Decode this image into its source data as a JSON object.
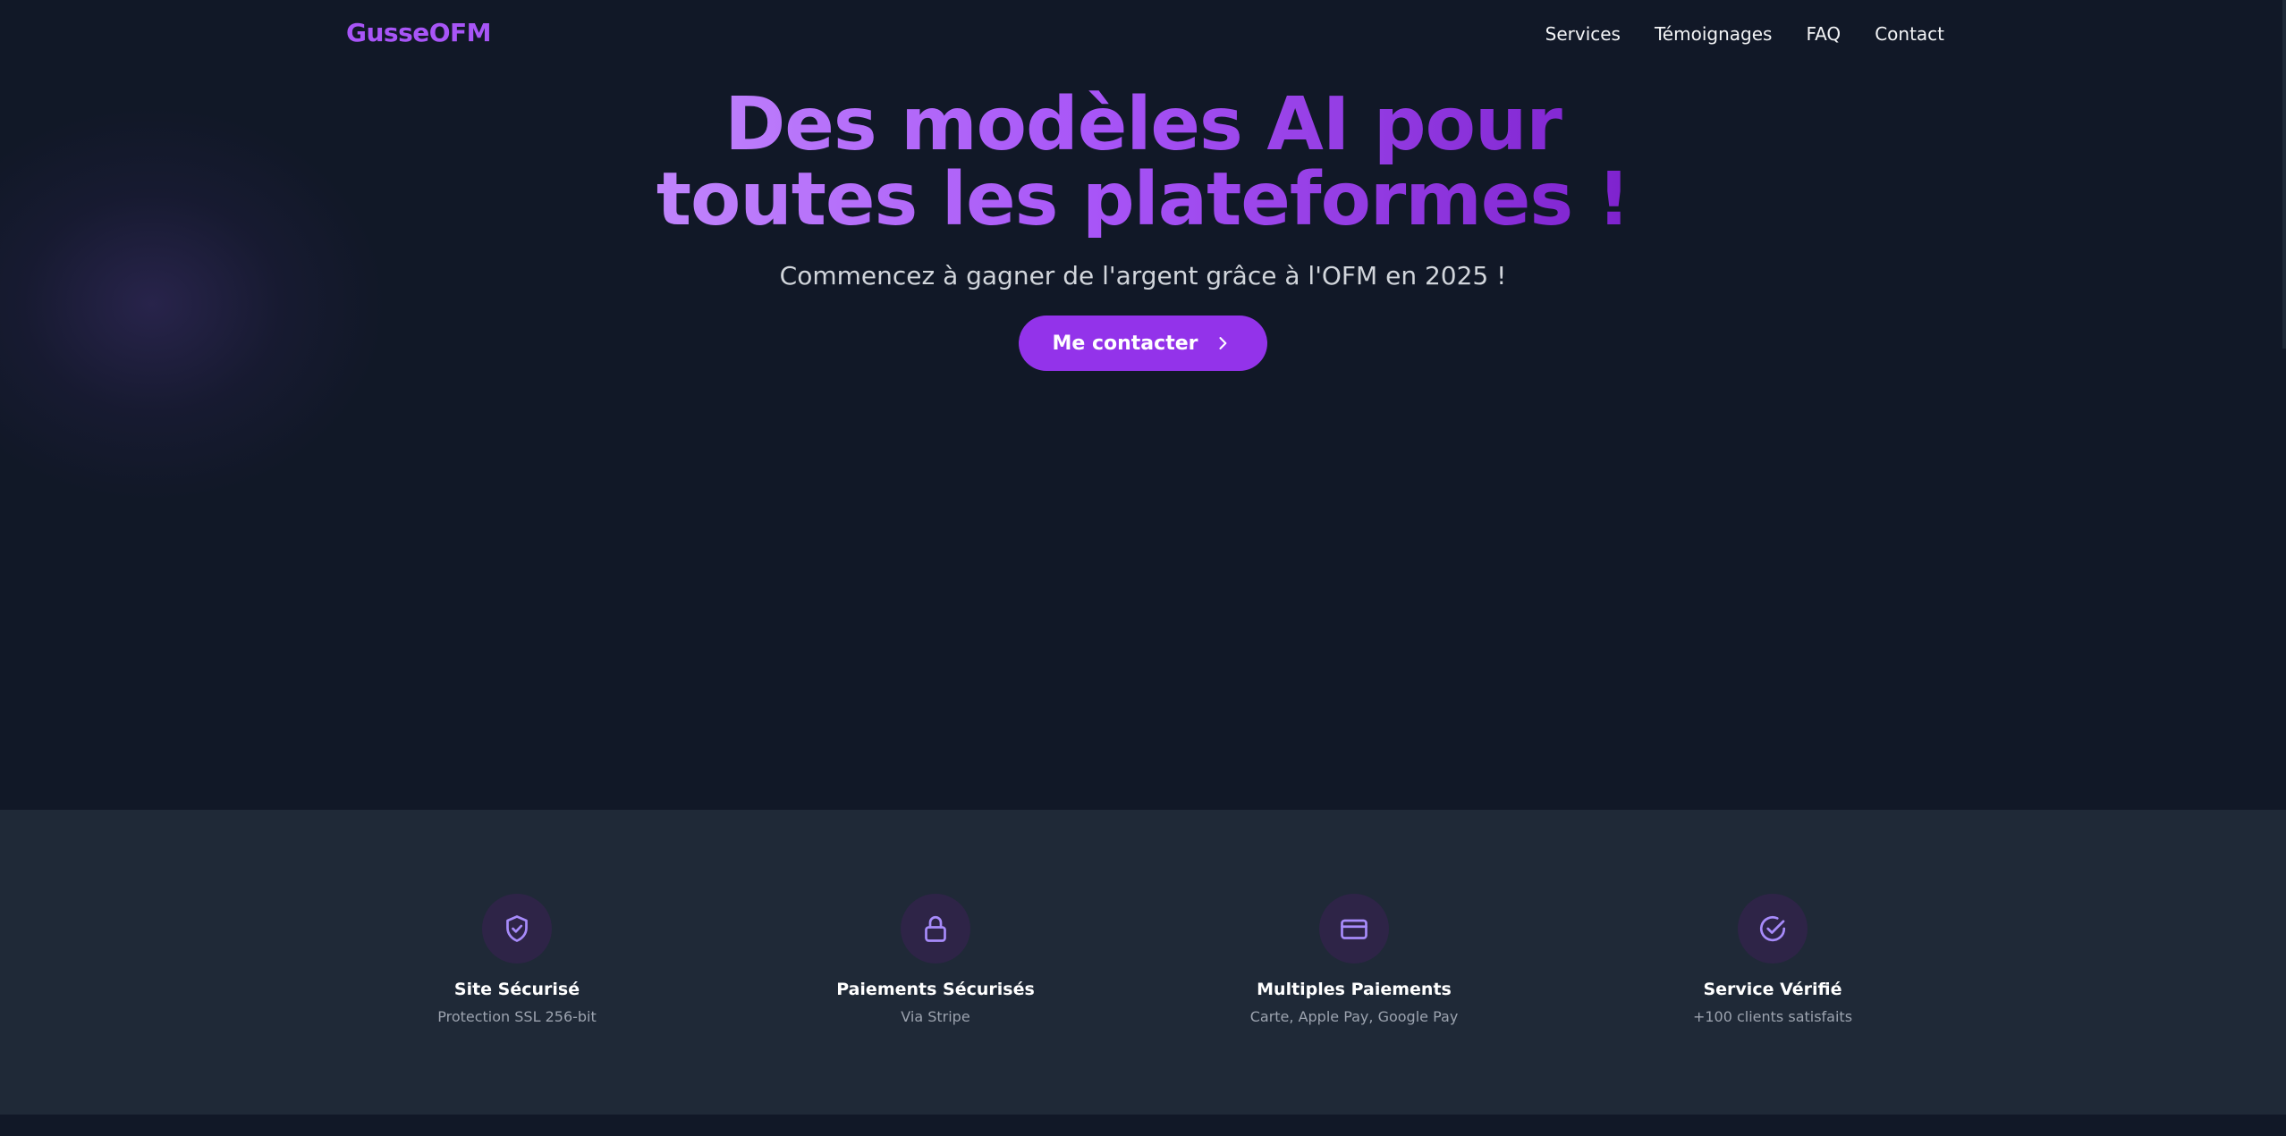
{
  "header": {
    "brand": "GusseOFM",
    "nav": [
      "Services",
      "Témoignages",
      "FAQ",
      "Contact"
    ]
  },
  "hero": {
    "title_line1": "Des modèles AI pour",
    "title_line2": "toutes les plateformes !",
    "subtitle": "Commencez à gagner de l'argent grâce à l'OFM en 2025 !",
    "cta_label": "Me contacter"
  },
  "features": [
    {
      "icon": "shield-check-icon",
      "title": "Site Sécurisé",
      "desc": "Protection SSL 256-bit"
    },
    {
      "icon": "lock-icon",
      "title": "Paiements Sécurisés",
      "desc": "Via Stripe"
    },
    {
      "icon": "credit-card-icon",
      "title": "Multiples Paiements",
      "desc": "Carte, Apple Pay, Google Pay"
    },
    {
      "icon": "check-circle-icon",
      "title": "Service Vérifié",
      "desc": "+100 clients satisfaits"
    }
  ],
  "colors": {
    "background": "#111827",
    "band": "#1f2937",
    "accent": "#9333ea",
    "brand": "#a855f7"
  }
}
